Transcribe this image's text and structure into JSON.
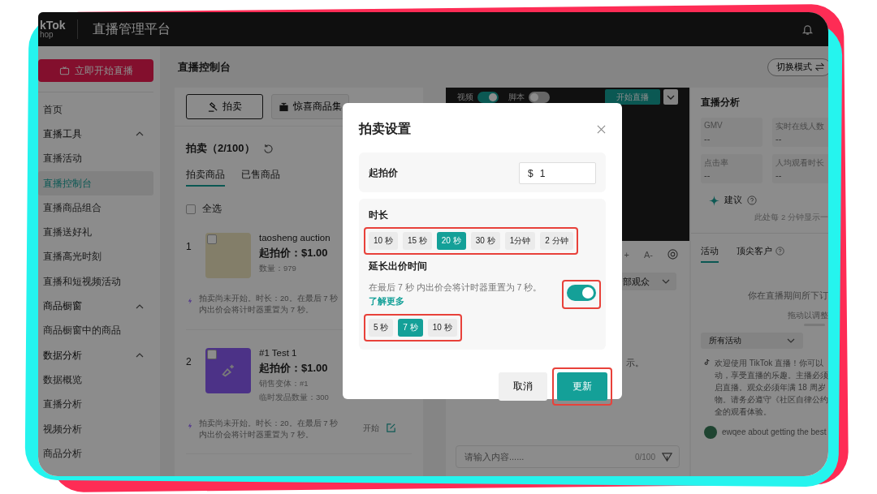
{
  "header": {
    "logo_top": "kTok",
    "logo_bottom": "hop",
    "title": "直播管理平台"
  },
  "sidebar": {
    "start_button": "立即开始直播",
    "items": [
      {
        "label": "首页",
        "selected": false
      },
      {
        "label": "直播工具",
        "selected": false,
        "expanded": true,
        "children": [
          {
            "label": "直播活动",
            "selected": false
          },
          {
            "label": "直播控制台",
            "selected": true
          },
          {
            "label": "直播商品组合",
            "selected": false
          },
          {
            "label": "直播送好礼",
            "selected": false
          },
          {
            "label": "直播高光时刻",
            "selected": false
          },
          {
            "label": "直播和短视频活动",
            "selected": false
          }
        ]
      },
      {
        "label": "商品橱窗",
        "selected": false,
        "expanded": true,
        "children": [
          {
            "label": "商品橱窗中的商品",
            "selected": false
          }
        ]
      },
      {
        "label": "数据分析",
        "selected": false,
        "expanded": true,
        "children": [
          {
            "label": "数据概览",
            "selected": false
          },
          {
            "label": "直播分析",
            "selected": false
          },
          {
            "label": "视频分析",
            "selected": false
          },
          {
            "label": "商品分析",
            "selected": false
          }
        ]
      }
    ]
  },
  "main": {
    "title": "直播控制台",
    "mode_button": "切换模式"
  },
  "left_panel": {
    "tool_buttons": [
      {
        "label": "拍卖",
        "kind": "auction",
        "selected": true
      },
      {
        "label": "惊喜商品集",
        "kind": "gift",
        "selected": false
      }
    ],
    "heading": "拍卖（2/100）",
    "tabs": [
      {
        "label": "拍卖商品",
        "selected": true
      },
      {
        "label": "已售商品",
        "selected": false
      }
    ],
    "select_all": {
      "label": "全选",
      "checked": false
    },
    "items": [
      {
        "index": "1",
        "kind": "photo",
        "checked": false,
        "title": "taosheng auction",
        "price": "起拍价：$1.00",
        "meta": [
          "数量：979"
        ],
        "note": "拍卖尚未开始。时长：20。在最后 7 秒内出价会将计时器重置为 7 秒。"
      },
      {
        "index": "2",
        "kind": "placeholder",
        "checked": false,
        "title": "#1 Test 1",
        "price": "起拍价：$1.00",
        "meta": [
          "销售变体：#1",
          "临时发品数量：300"
        ],
        "note": "拍卖尚未开始。时长：20。在最后 7 秒内出价会将计时器重置为 7 秒。",
        "action": "开始"
      }
    ]
  },
  "stream_panel": {
    "toggles": [
      {
        "label": "视频",
        "on": true
      },
      {
        "label": "脚本",
        "on": false
      }
    ],
    "start_button": "开始直播",
    "font_buttons": [
      "+",
      "A-"
    ],
    "audience_dropdown": "部观众",
    "hint": "示。",
    "input": {
      "placeholder": "请输入内容......",
      "counter": "0/100"
    }
  },
  "analytics": {
    "title": "直播分析",
    "metrics": [
      {
        "label": "GMV",
        "value": "--"
      },
      {
        "label": "实时在线人数",
        "value": "--"
      },
      {
        "label": "点击率",
        "value": "--"
      },
      {
        "label": "人均观看时长",
        "value": "--"
      }
    ],
    "suggestion": {
      "label": "建议",
      "hint": "此处每 2 分钟显示一"
    },
    "tabs": [
      {
        "label": "活动",
        "selected": true,
        "help": false
      },
      {
        "label": "顶尖客户",
        "selected": false,
        "help": true
      }
    ],
    "empty_text": "你在直播期间所下订",
    "drag_hint": "拖动以调整",
    "filter": "所有活动",
    "messages": [
      {
        "kind": "system",
        "lines": [
          "欢迎使用 TikTok 直播！你可以",
          "动，享受直播的乐趣。主播必须",
          "启直播。观众必须年满 18 周岁",
          "物。请务必遵守《社区自律公约",
          "全的观看体验。"
        ]
      },
      {
        "kind": "user",
        "lines": [
          "ewqee about getting the best"
        ]
      }
    ]
  },
  "modal": {
    "title": "拍卖设置",
    "start_price": {
      "label": "起拍价",
      "currency": "$",
      "value": "1"
    },
    "duration": {
      "label": "时长",
      "options": [
        {
          "label": "10 秒",
          "selected": false
        },
        {
          "label": "15 秒",
          "selected": false
        },
        {
          "label": "20 秒",
          "selected": true
        },
        {
          "label": "30 秒",
          "selected": false
        },
        {
          "label": "1分钟",
          "selected": false
        },
        {
          "label": "2 分钟",
          "selected": false
        }
      ]
    },
    "extend": {
      "label": "延长出价时间",
      "description": "在最后 7 秒 内出价会将计时器重置为 7 秒。",
      "link": "了解更多",
      "on": true,
      "options": [
        {
          "label": "5 秒",
          "selected": false
        },
        {
          "label": "7 秒",
          "selected": true
        },
        {
          "label": "10 秒",
          "selected": false
        }
      ]
    },
    "cancel": "取消",
    "confirm": "更新"
  }
}
